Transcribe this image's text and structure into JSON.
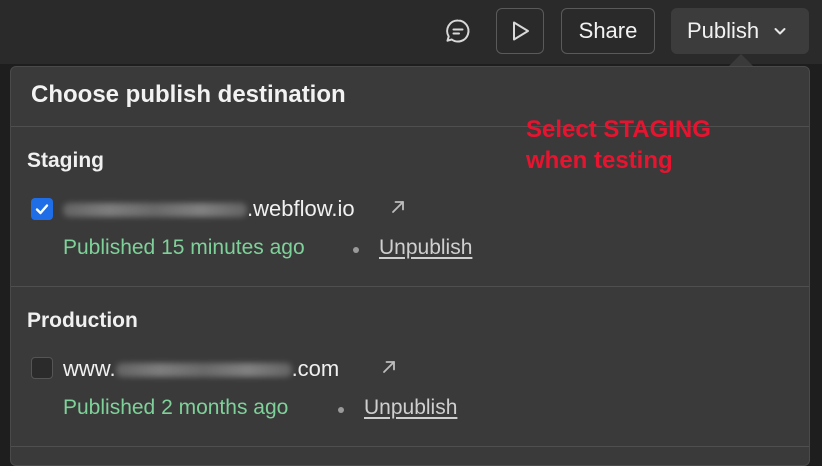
{
  "topbar": {
    "share_label": "Share",
    "publish_label": "Publish",
    "icons": [
      "comment-icon",
      "play-icon",
      "chevron-down-icon"
    ]
  },
  "panel": {
    "title": "Choose publish destination",
    "sections": [
      {
        "heading": "Staging",
        "domain_prefix": "",
        "domain_suffix": ".webflow.io",
        "checked": true,
        "status": "Published 15 minutes ago",
        "action": "Unpublish"
      },
      {
        "heading": "Production",
        "domain_prefix": "www.",
        "domain_suffix": ".com",
        "checked": false,
        "status": "Published 2 months ago",
        "action": "Unpublish"
      }
    ]
  },
  "annotation": {
    "line1": "Select STAGING",
    "line2": "when testing",
    "color": "#e8142f"
  },
  "colors": {
    "checkbox_accent": "#1f6ee8",
    "status_green": "#7fd19a",
    "panel_bg": "#3a3a3a"
  }
}
